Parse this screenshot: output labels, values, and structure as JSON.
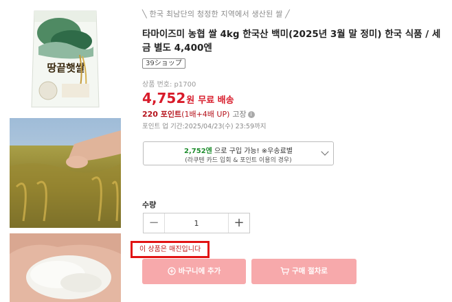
{
  "product": {
    "tagline": "╲ 한국 최남단의 청정한 지역에서 생산된 쌀 ╱",
    "title": "타마이즈미 농협 쌀 4kg 한국산 백미(2025년 3월 말 정미) 한국 식품 / 세금 별도 4,400엔",
    "shop_badge": "39ショップ",
    "product_number": "상품 번호: p1700",
    "bag_logo_text": "땅끝햇쌀"
  },
  "pricing": {
    "price": "4,752",
    "price_unit": "원",
    "shipping": "무료 배송",
    "points": "220 포인트",
    "points_multiplier": "(1배+4배 UP)",
    "points_note": "고장",
    "points_deadline": "포인트 업 기간:2025/04/23(수) 23:59까지"
  },
  "discount": {
    "price": "2,752엔",
    "line1_suffix": "으로 구입 가능! ※우송료별",
    "line2": "(라쿠텐 카드 입회 & 포인트 이용의 경우)"
  },
  "quantity": {
    "label": "수량",
    "value": "1",
    "minus": "−",
    "plus": "+"
  },
  "notice": {
    "soldout": "이 상품은 매진입니다"
  },
  "actions": {
    "cart_label": "바구니에 추가",
    "buy_label": "구매 절차로"
  },
  "colors": {
    "price_red": "#d81b2a",
    "discount_green": "#1f8d2e",
    "disabled_button": "#f7a9ab",
    "highlight_border": "#e11212"
  },
  "icons": {
    "info": "info-icon",
    "chevron": "chevron-down-icon",
    "cart": "plus-circle-icon",
    "buy": "cart-icon"
  }
}
